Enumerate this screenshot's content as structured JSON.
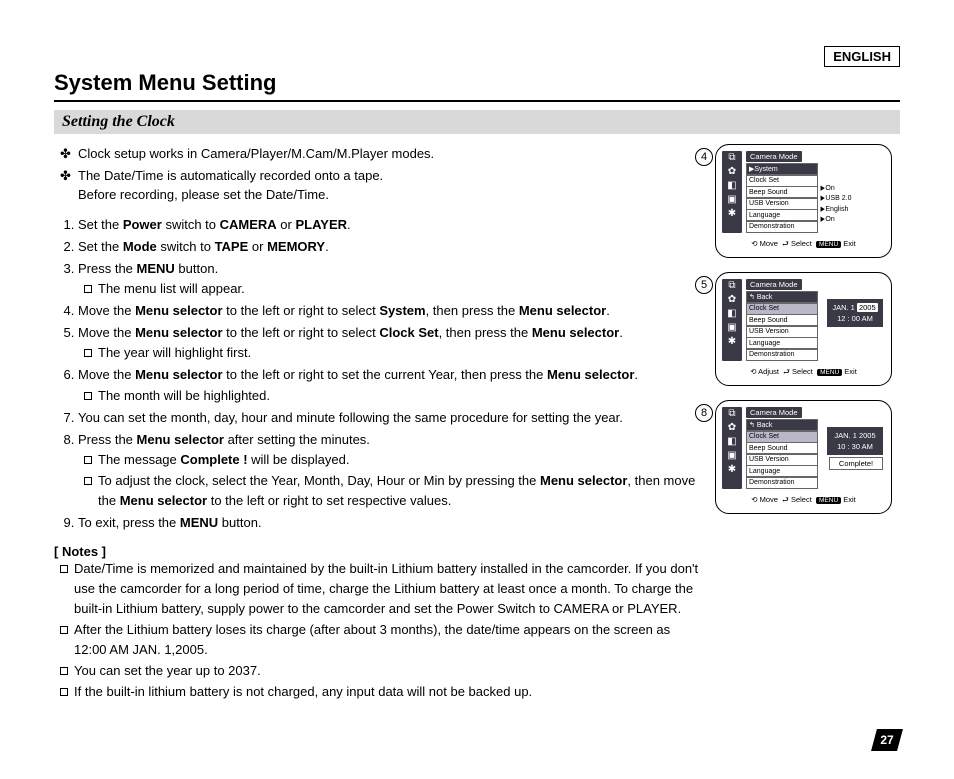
{
  "lang_label": "ENGLISH",
  "title": "System Menu Setting",
  "subhead": "Setting the Clock",
  "intro": [
    "Clock setup works in Camera/Player/M.Cam/M.Player modes.",
    "The Date/Time is automatically recorded onto a tape.\nBefore recording, please set the Date/Time."
  ],
  "steps": [
    {
      "pre": "Set the ",
      "b1": "Power",
      "mid": " switch to ",
      "b2": "CAMERA",
      "mid2": " or ",
      "b3": "PLAYER",
      "post": "."
    },
    {
      "pre": "Set the ",
      "b1": "Mode",
      "mid": " switch to ",
      "b2": "TAPE",
      "mid2": " or ",
      "b3": "MEMORY",
      "post": "."
    },
    {
      "pre": "Press the ",
      "b1": "MENU",
      "mid": " button.",
      "sub": [
        "The menu list will appear."
      ]
    },
    {
      "pre": "Move the ",
      "b1": "Menu selector",
      "mid": " to the left or right to select ",
      "b2": "System",
      "mid2": ", then press the ",
      "b3": "Menu selector",
      "post": "."
    },
    {
      "pre": "Move the ",
      "b1": "Menu selector",
      "mid": " to the left or right to select ",
      "b2": "Clock Set",
      "mid2": ", then press the ",
      "b3": "Menu selector",
      "post": ".",
      "sub": [
        "The year will highlight first."
      ]
    },
    {
      "pre": "Move the ",
      "b1": "Menu selector",
      "mid": " to the left or right to set the current Year, then press the ",
      "b2": "Menu selector",
      "post": ".",
      "sub": [
        "The month will be highlighted."
      ]
    },
    {
      "plain": "You can set the month, day, hour and minute following the same procedure for setting the year."
    },
    {
      "pre": "Press the ",
      "b1": "Menu selector",
      "mid": " after setting the minutes.",
      "sub": [
        "The message Complete ! will be displayed.",
        "To adjust the clock, select the Year, Month, Day, Hour or Min by pressing the Menu selector, then move the Menu selector to the left or right to set respective values."
      ],
      "sub_complete_bold": "Complete !",
      "sub_ms_bold": "Menu selector"
    },
    {
      "pre": "To exit, press the ",
      "b1": "MENU",
      "mid": " button."
    }
  ],
  "notes_h": "[ Notes ]",
  "notes": [
    "Date/Time is memorized and maintained by the built-in Lithium battery installed in the camcorder. If you don't use the camcorder for a long period of time, charge the Lithium battery at least once a month. To charge the built-in Lithium battery, supply power to the camcorder and set the Power Switch to CAMERA or PLAYER.",
    "After the Lithium battery loses its charge (after about 3 months), the date/time appears on the screen as 12:00 AM JAN. 1,2005.",
    "You can set the year up to 2037.",
    "If the built-in lithium battery is not charged, any input data will not be backed up."
  ],
  "screens": {
    "labels": {
      "camera_mode": "Camera Mode",
      "system": "System",
      "back": "Back",
      "clock_set": "Clock Set",
      "beep_sound": "Beep Sound",
      "usb_version": "USB Version",
      "language": "Language",
      "demonstration": "Demonstration"
    },
    "vals": {
      "on": "On",
      "usb20": "USB 2.0",
      "english": "English"
    },
    "foot": {
      "move": "Move",
      "adjust": "Adjust",
      "select": "Select",
      "exit": "Exit",
      "menu": "MENU"
    },
    "s4_badge": "4",
    "s5_badge": "5",
    "s8_badge": "8",
    "s5_date_l1": "JAN. 1",
    "s5_year": "2005",
    "s5_date_l2": "12 : 00   AM",
    "s8_date_l1": "JAN. 1  2005",
    "s8_date_l2": "10 : 30  AM",
    "complete": "Complete!"
  },
  "page_number": "27"
}
